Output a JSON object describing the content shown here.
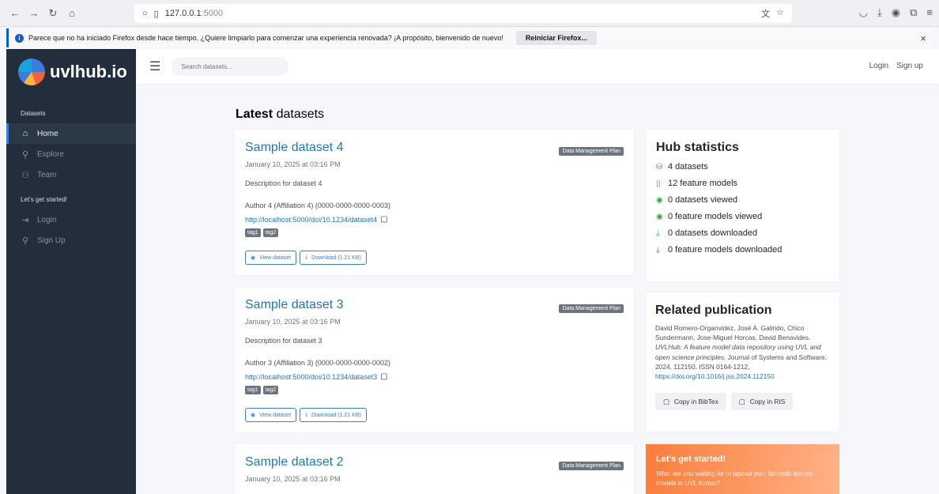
{
  "browser": {
    "url_host": "127.0.0.1",
    "url_port": ":5000",
    "notification": "Parece que no ha iniciado Firefox desde hace tiempo. ¿Quiere limpiarlo para comenzar una experiencia renovada? ¡A propósito, bienvenido de nuevo!",
    "reset_label": "Reiniciar Firefox..."
  },
  "sidebar": {
    "brand": "uvlhub.io",
    "section1": "Datasets",
    "items1": [
      {
        "label": "Home",
        "icon": "home-icon"
      },
      {
        "label": "Explore",
        "icon": "search-icon"
      },
      {
        "label": "Team",
        "icon": "users-icon"
      }
    ],
    "section2": "Let's get started!",
    "items2": [
      {
        "label": "Login",
        "icon": "login-icon"
      },
      {
        "label": "Sign Up",
        "icon": "user-plus-icon"
      }
    ]
  },
  "topbar": {
    "search_placeholder": "Search datasets...",
    "login": "Login",
    "signup": "Sign up"
  },
  "main": {
    "title_bold": "Latest",
    "title_rest": " datasets",
    "datasets": [
      {
        "title": "Sample dataset 4",
        "badge": "Data Management Plan",
        "date": "January 10, 2025 at 03:16 PM",
        "description": "Description for dataset 4",
        "author": "Author 4 (Affiliation 4) (0000-0000-0000-0003)",
        "doi": "http://localhost:5000/doi/10.1234/dataset4",
        "tags": [
          "tag1",
          "tag2"
        ],
        "view_label": "View dataset",
        "download_label": "Download (1.21 KB)"
      },
      {
        "title": "Sample dataset 3",
        "badge": "Data Management Plan",
        "date": "January 10, 2025 at 03:16 PM",
        "description": "Description for dataset 3",
        "author": "Author 3 (Affiliation 3) (0000-0000-0000-0002)",
        "doi": "http://localhost:5000/doi/10.1234/dataset3",
        "tags": [
          "tag1",
          "tag2"
        ],
        "view_label": "View dataset",
        "download_label": "Download (1.21 KB)"
      },
      {
        "title": "Sample dataset 2",
        "badge": "Data Management Plan",
        "date": "January 10, 2025 at 03:16 PM"
      }
    ]
  },
  "stats": {
    "title": "Hub statistics",
    "items": [
      {
        "text": "4 datasets",
        "icon": "database-icon"
      },
      {
        "text": "12 feature models",
        "icon": "file-icon"
      },
      {
        "text": "0 datasets viewed",
        "icon": "eye-icon"
      },
      {
        "text": "0 feature models viewed",
        "icon": "eye-icon"
      },
      {
        "text": "0 datasets downloaded",
        "icon": "download-icon"
      },
      {
        "text": "0 feature models downloaded",
        "icon": "download-icon"
      }
    ]
  },
  "publication": {
    "title": "Related publication",
    "authors": "David Romero-Organvidez, José A. Galindo, Chico Sundermann, Jose-Miguel Horcas, David Benavides.",
    "paper_title": "UVLHub: A feature model data repository using UVL and open science principles,",
    "journal": " Journal of Systems and Software, 2024, 112150, ISSN 0164-1212, ",
    "link": "https://doi.org/10.1016/j.jss.2024.112150",
    "bibtex_label": "Copy in BibTex",
    "ris_label": "Copy in RIS"
  },
  "start": {
    "title": "Let's get started!",
    "text": "What are you waiting for to upload your fantastic feature models in UVL format?"
  }
}
